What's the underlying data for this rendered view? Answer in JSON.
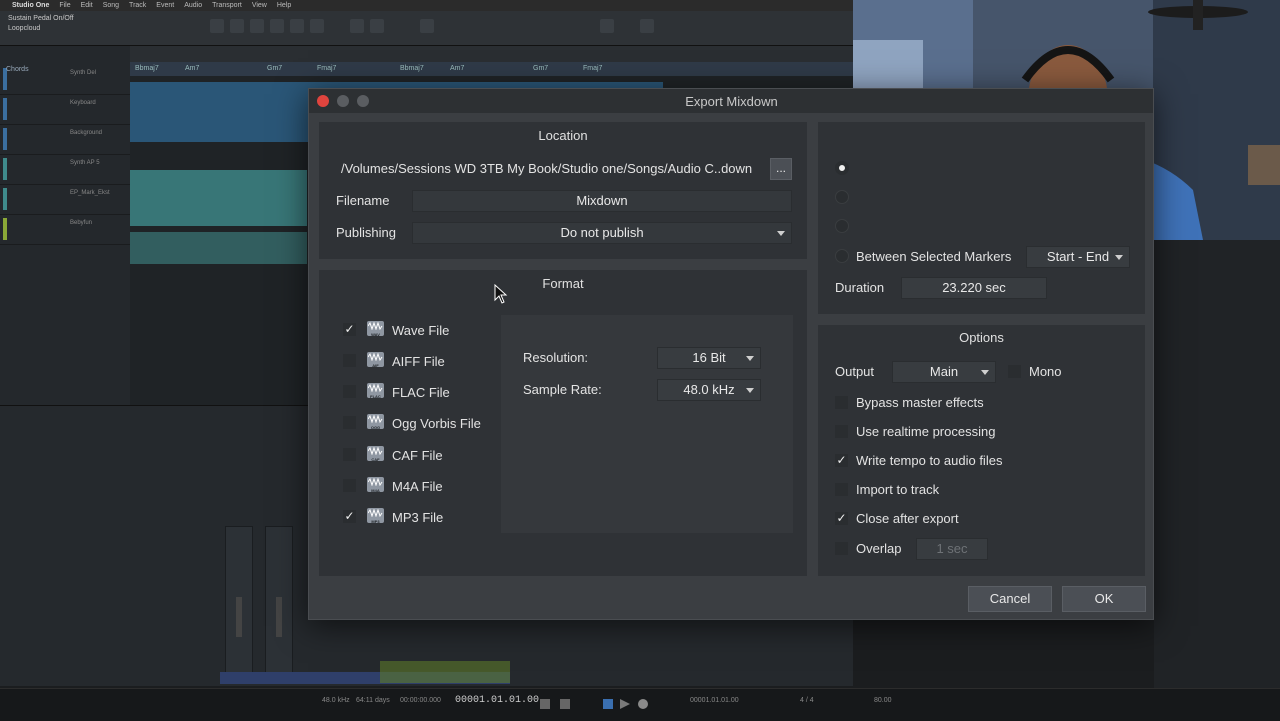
{
  "daw": {
    "menu": [
      "Studio One",
      "File",
      "Edit",
      "Song",
      "Track",
      "Event",
      "Audio",
      "Transport",
      "View",
      "Help"
    ],
    "song_name": "Sustain Pedal On/Off",
    "song_sub": "Loopcloud",
    "tracks": [
      "Chords",
      "Synth Del",
      "Keyboard",
      "Background",
      "Synth AP 5",
      "EP_Mark_Ekst",
      "Bebyfun"
    ],
    "chord_marks": [
      "Bbmaj7",
      "Am7",
      "Gm7",
      "Fmaj7",
      "Bbmaj7",
      "Am7",
      "Gm7",
      "Fmaj7"
    ],
    "timecode": "00001.01.01.00",
    "transport_labels": [
      "48.0 kHz",
      "64:11 days",
      "00:00:00.000",
      "00001.01.01.00",
      "4 / 4",
      "80.00"
    ],
    "colors": {
      "clip_blue": "#2d5f86",
      "clip_teal": "#3f8b8c"
    }
  },
  "dialog": {
    "title": "Export Mixdown",
    "location": {
      "title": "Location",
      "path": "/Volumes/Sessions WD 3TB My Book/Studio one/Songs/Audio C..down",
      "browse_label": "...",
      "filename_label": "Filename",
      "filename_value": "Mixdown",
      "publishing_label": "Publishing",
      "publishing_value": "Do not publish"
    },
    "format": {
      "title": "Format",
      "files": [
        {
          "label": "Wave File",
          "tag": "WAV",
          "checked": true
        },
        {
          "label": "AIFF File",
          "tag": "AIF",
          "checked": false
        },
        {
          "label": "FLAC File",
          "tag": "FLAC",
          "checked": false
        },
        {
          "label": "Ogg Vorbis File",
          "tag": "OGG",
          "checked": false
        },
        {
          "label": "CAF File",
          "tag": "CAF",
          "checked": false
        },
        {
          "label": "M4A File",
          "tag": "M4A",
          "checked": false
        },
        {
          "label": "MP3 File",
          "tag": "MP3",
          "checked": true
        }
      ],
      "resolution_label": "Resolution:",
      "resolution_value": "16 Bit",
      "sample_rate_label": "Sample Rate:",
      "sample_rate_value": "48.0 kHz"
    },
    "range": {
      "between_markers_label": "Between Selected Markers",
      "markers_value": "Start - End",
      "duration_label": "Duration",
      "duration_value": "23.220 sec"
    },
    "options": {
      "title": "Options",
      "output_label": "Output",
      "output_value": "Main",
      "mono_label": "Mono",
      "mono_checked": false,
      "checks": [
        {
          "label": "Bypass master effects",
          "checked": false
        },
        {
          "label": "Use realtime processing",
          "checked": false
        },
        {
          "label": "Write tempo to audio files",
          "checked": true
        },
        {
          "label": "Import to track",
          "checked": false
        },
        {
          "label": "Close after export",
          "checked": true
        }
      ],
      "overlap_label": "Overlap",
      "overlap_checked": false,
      "overlap_value": "1 sec"
    },
    "buttons": {
      "cancel": "Cancel",
      "ok": "OK"
    }
  }
}
